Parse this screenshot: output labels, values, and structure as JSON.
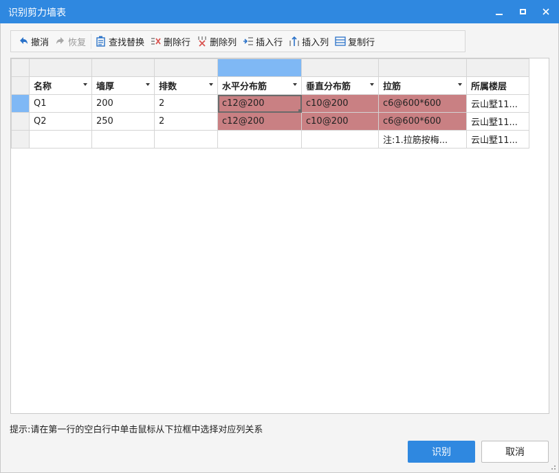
{
  "window": {
    "title": "识别剪力墙表",
    "controls": [
      "minimize-icon",
      "maximize-icon",
      "close-icon"
    ]
  },
  "toolbar": {
    "undo": "撤消",
    "redo": "恢复",
    "find_replace": "查找替换",
    "delete_row": "删除行",
    "delete_col": "删除列",
    "insert_row": "插入行",
    "insert_col": "插入列",
    "copy_row": "复制行"
  },
  "table": {
    "headers": [
      "名称",
      "墙厚",
      "排数",
      "水平分布筋",
      "垂直分布筋",
      "拉筋",
      "所属楼层"
    ],
    "rows": [
      [
        "Q1",
        "200",
        "2",
        "c12@200",
        "c10@200",
        "c6@600*600",
        "云山墅11..."
      ],
      [
        "Q2",
        "250",
        "2",
        "c12@200",
        "c10@200",
        "c6@600*600",
        "云山墅11..."
      ],
      [
        "",
        "",
        "",
        "",
        "",
        "注:1.拉筋按梅...",
        "云山墅11..."
      ]
    ]
  },
  "hint": "提示:请在第一行的空白行中单击鼠标从下拉框中选择对应列关系",
  "buttons": {
    "recognize": "识别",
    "cancel": "取消"
  },
  "colors": {
    "accent": "#2f88e0",
    "selected_column": "#7fb8f5",
    "highlight_cell": "#c98083"
  }
}
